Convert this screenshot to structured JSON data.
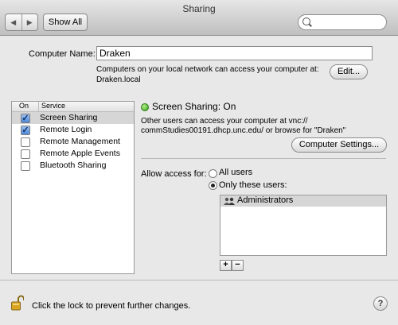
{
  "window": {
    "title": "Sharing"
  },
  "toolbar": {
    "back_glyph": "◀",
    "forward_glyph": "▶",
    "show_all_label": "Show All",
    "search_value": "",
    "search_placeholder": ""
  },
  "computer": {
    "label": "Computer Name:",
    "name": "Draken",
    "note_line1": "Computers on your local network can access your computer at:",
    "note_line2": "Draken.local",
    "edit_label": "Edit..."
  },
  "services": {
    "header_on": "On",
    "header_service": "Service",
    "items": [
      {
        "label": "Screen Sharing",
        "checked": true,
        "selected": true
      },
      {
        "label": "Remote Login",
        "checked": true,
        "selected": false
      },
      {
        "label": "Remote Management",
        "checked": false,
        "selected": false
      },
      {
        "label": "Remote Apple Events",
        "checked": false,
        "selected": false
      },
      {
        "label": "Bluetooth Sharing",
        "checked": false,
        "selected": false
      }
    ]
  },
  "detail": {
    "status": "Screen Sharing: On",
    "status_color": "#2f9e1a",
    "desc_line1": "Other users can access your computer at vnc://",
    "desc_line2": "commStudies00191.dhcp.unc.edu/ or browse for \"Draken\"",
    "settings_label": "Computer Settings...",
    "allow_label": "Allow access for:",
    "option_all": "All users",
    "option_these": "Only these users:",
    "selected_option": "these",
    "users": [
      "Administrators"
    ],
    "add_label": "+",
    "remove_label": "−"
  },
  "footer": {
    "lock_text": "Click the lock to prevent further changes.",
    "help_label": "?"
  },
  "icons": {
    "nav": [
      "back-arrow-icon",
      "forward-arrow-icon"
    ],
    "search": "magnifier-icon",
    "status": "green-status-icon",
    "group": "group-users-icon",
    "lock": "padlock-open-icon",
    "help": "help-icon"
  }
}
